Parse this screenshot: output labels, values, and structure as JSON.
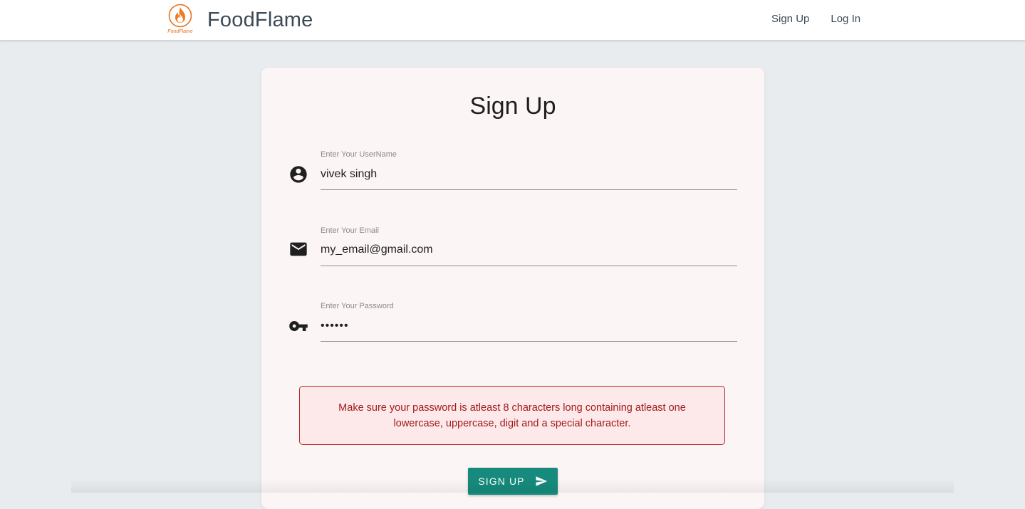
{
  "header": {
    "brand_name": "FoodFlame",
    "logo_caption": "FoodFlame",
    "nav": [
      {
        "label": "Sign Up"
      },
      {
        "label": "Log In"
      }
    ]
  },
  "form": {
    "title": "Sign Up",
    "fields": [
      {
        "label": "Enter Your UserName",
        "value": "vivek singh",
        "icon": "account-circle-icon"
      },
      {
        "label": "Enter Your Email",
        "value": "my_email@gmail.com",
        "icon": "mail-icon"
      },
      {
        "label": "Enter Your Password",
        "value": "••••••",
        "icon": "key-icon"
      }
    ],
    "error_message": "Make sure your password is atleast 8 characters long containing atleast one lowercase, uppercase, digit and a special character.",
    "submit_label": "SIGN UP",
    "submit_icon": "send-icon"
  },
  "colors": {
    "brand": "#e8711f",
    "primary_button": "#168a7c",
    "error_text": "#a31b1b",
    "error_border": "#b42a2a",
    "error_background": "#fde8ea",
    "page_background": "#e9ecef",
    "card_background": "#fcf5f5"
  }
}
